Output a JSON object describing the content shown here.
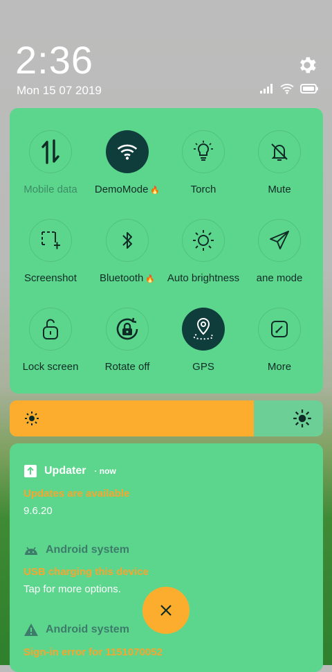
{
  "status": {
    "time": "2:36",
    "date": "Mon 15 07 2019"
  },
  "quick_settings": [
    {
      "label": "Mobile data",
      "icon": "mobile-data-icon",
      "active": false,
      "dim": true
    },
    {
      "label": "DemoMode",
      "icon": "wifi-icon",
      "active": true,
      "flame": true
    },
    {
      "label": "Torch",
      "icon": "torch-icon",
      "active": false
    },
    {
      "label": "Mute",
      "icon": "mute-icon",
      "active": false
    },
    {
      "label": "Screenshot",
      "icon": "screenshot-icon",
      "active": false
    },
    {
      "label": "Bluetooth",
      "icon": "bluetooth-icon",
      "active": false,
      "flame": true
    },
    {
      "label": "Auto brightness",
      "icon": "auto-brightness-icon",
      "active": false
    },
    {
      "label": "ane mode",
      "icon": "airplane-mode-icon",
      "active": false
    },
    {
      "label": "Lock screen",
      "icon": "lock-screen-icon",
      "active": false
    },
    {
      "label": "Rotate off",
      "icon": "rotate-lock-icon",
      "active": false
    },
    {
      "label": "GPS",
      "icon": "gps-icon",
      "active": true
    },
    {
      "label": "More",
      "icon": "more-edit-icon",
      "active": false
    }
  ],
  "brightness": {
    "level_percent": 78
  },
  "notifications": [
    {
      "app": "Updater",
      "when": "now",
      "title": "Updates are available",
      "body": "9.6.20",
      "icon": "updater-icon"
    },
    {
      "app": "Android system",
      "title": "USB charging this device",
      "body": "Tap for more options.",
      "icon": "android-icon"
    },
    {
      "app": "Android system",
      "title": "Sign-in error for 1151070052",
      "icon": "warning-icon"
    }
  ],
  "colors": {
    "panel": "#5cd68d",
    "accent": "#fdad2d",
    "active_tile": "#0f3d3c"
  }
}
